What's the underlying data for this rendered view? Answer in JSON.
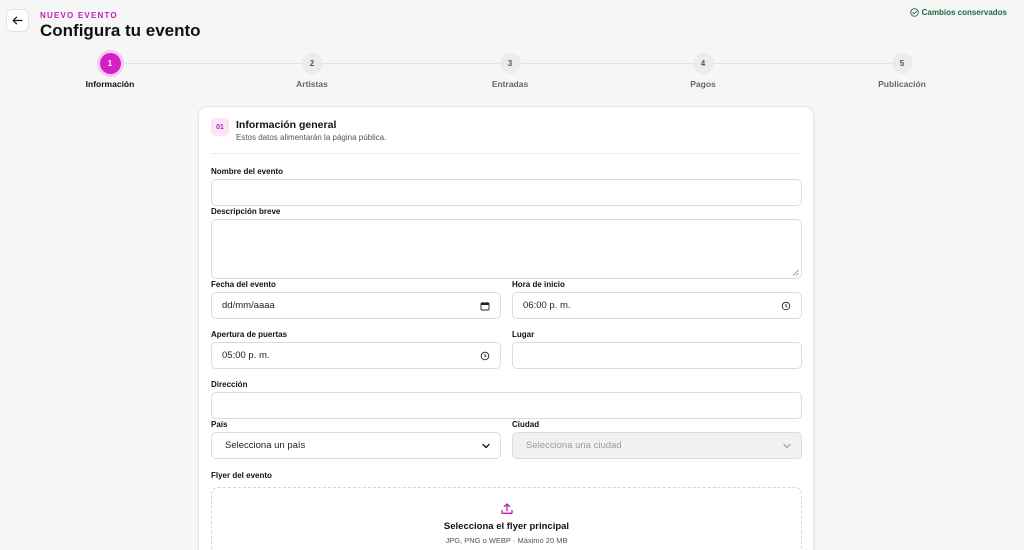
{
  "header": {
    "back_icon": "arrow-left-icon",
    "eyebrow": "NUEVO EVENTO",
    "title": "Configura tu evento",
    "saved_status": "Cambios conservados",
    "saved_icon": "check-circle-icon"
  },
  "stepper": {
    "steps": [
      {
        "number": "1",
        "label": "Información",
        "active": true
      },
      {
        "number": "2",
        "label": "Artistas",
        "active": false
      },
      {
        "number": "3",
        "label": "Entradas",
        "active": false
      },
      {
        "number": "4",
        "label": "Pagos",
        "active": false
      },
      {
        "number": "5",
        "label": "Publicación",
        "active": false
      }
    ]
  },
  "form": {
    "section_number": "01",
    "section_title": "Información general",
    "section_subtitle": "Estos datos alimentarán la página pública.",
    "fields": {
      "event_name": {
        "label": "Nombre del evento",
        "value": ""
      },
      "description": {
        "label": "Descripción breve",
        "value": ""
      },
      "event_date": {
        "label": "Fecha del evento",
        "value": "dd/mm/aaaa"
      },
      "start_time": {
        "label": "Hora de inicio",
        "value": "06:00 p. m."
      },
      "doors_open": {
        "label": "Apertura de puertas",
        "value": "05:00 p. m."
      },
      "venue": {
        "label": "Lugar",
        "value": ""
      },
      "address": {
        "label": "Dirección",
        "value": ""
      },
      "country": {
        "label": "País",
        "value": "Selecciona un país"
      },
      "city": {
        "label": "Ciudad",
        "value": "Selecciona una ciudad"
      }
    },
    "flyer": {
      "label": "Flyer del evento",
      "title": "Selecciona el flyer principal",
      "hint": "JPG, PNG o WEBP · Máximo 20 MB"
    }
  },
  "colors": {
    "accent": "#d41fc4",
    "accent_soft": "#fbe4f7",
    "success": "#1e6a3f"
  }
}
